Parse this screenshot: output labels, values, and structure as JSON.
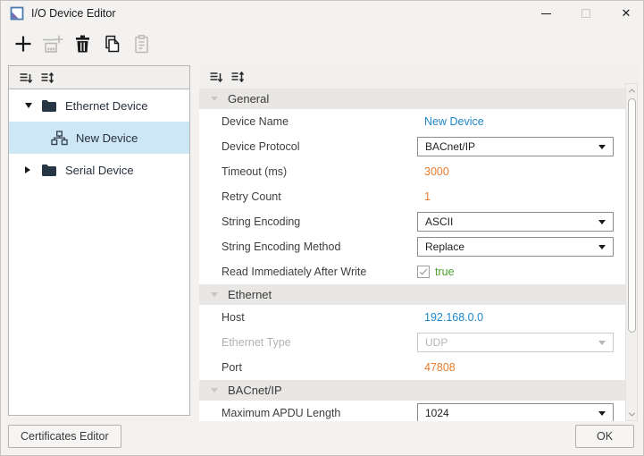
{
  "window": {
    "title": "I/O Device Editor"
  },
  "toolbar": {
    "buttons": [
      {
        "name": "add",
        "icon": "plus-icon",
        "enabled": true
      },
      {
        "name": "add-device",
        "icon": "add-device-icon",
        "enabled": false
      },
      {
        "name": "delete",
        "icon": "trash-icon",
        "enabled": true
      },
      {
        "name": "copy",
        "icon": "copy-icon",
        "enabled": true
      },
      {
        "name": "paste",
        "icon": "paste-icon",
        "enabled": false
      }
    ]
  },
  "tree": {
    "items": [
      {
        "label": "Ethernet Device",
        "type": "folder",
        "expanded": true,
        "selected": false
      },
      {
        "label": "New Device",
        "type": "device",
        "selected": true
      },
      {
        "label": "Serial Device",
        "type": "folder",
        "expanded": false,
        "selected": false
      }
    ]
  },
  "properties": {
    "sections": [
      {
        "label": "General",
        "rows": [
          {
            "label": "Device Name",
            "value": "New Device",
            "editor": "text",
            "color": "blue"
          },
          {
            "label": "Device Protocol",
            "value": "BACnet/IP",
            "editor": "dropdown"
          },
          {
            "label": "Timeout (ms)",
            "value": "3000",
            "editor": "text",
            "color": "orange"
          },
          {
            "label": "Retry Count",
            "value": "1",
            "editor": "text",
            "color": "orange"
          },
          {
            "label": "String Encoding",
            "value": "ASCII",
            "editor": "dropdown"
          },
          {
            "label": "String Encoding Method",
            "value": "Replace",
            "editor": "dropdown"
          },
          {
            "label": "Read Immediately After Write",
            "value": "true",
            "editor": "checkbox",
            "checked": true,
            "color": "green"
          }
        ]
      },
      {
        "label": "Ethernet",
        "rows": [
          {
            "label": "Host",
            "value": "192.168.0.0",
            "editor": "text",
            "color": "blue"
          },
          {
            "label": "Ethernet Type",
            "value": "UDP",
            "editor": "dropdown",
            "disabled": true
          },
          {
            "label": "Port",
            "value": "47808",
            "editor": "text",
            "color": "orange"
          }
        ]
      },
      {
        "label": "BACnet/IP",
        "rows": [
          {
            "label": "Maximum APDU Length",
            "value": "1024",
            "editor": "dropdown"
          }
        ]
      }
    ]
  },
  "footer": {
    "certificates_button": "Certificates Editor",
    "ok_button": "OK"
  },
  "colors": {
    "value_blue": "#1f87c9",
    "value_orange": "#e87c2e",
    "value_green": "#49a02e",
    "selection_blue": "#cde7f7",
    "section_header_bg": "#e9e7e5",
    "dialog_bg": "#f3f2f1"
  }
}
